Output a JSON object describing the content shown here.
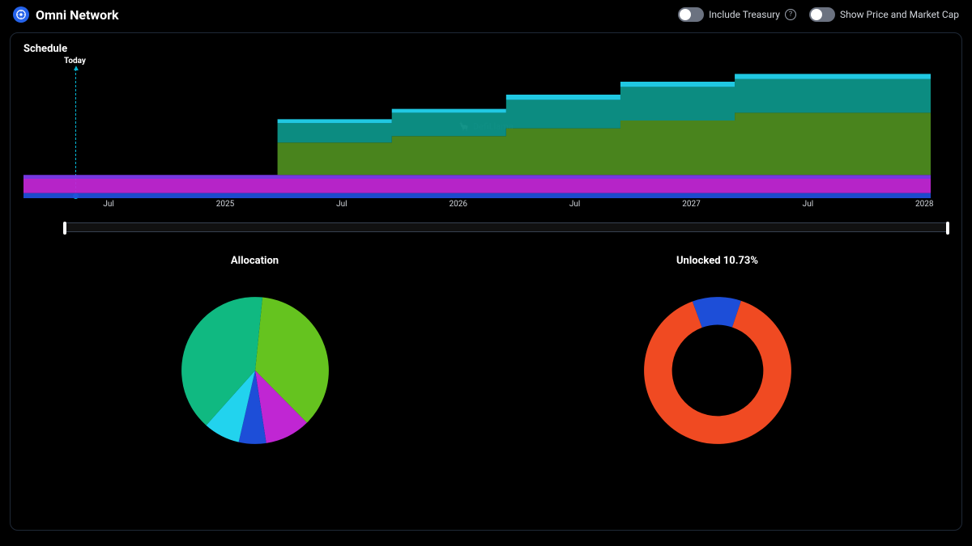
{
  "header": {
    "title": "Omni Network",
    "toggles": {
      "treasury_label": "Include Treasury",
      "price_label": "Show Price and Market Cap"
    }
  },
  "schedule": {
    "label": "Schedule",
    "today_label": "Today",
    "watermark": "DefiLlama"
  },
  "charts": {
    "allocation_title": "Allocation",
    "unlocked_title": "Unlocked 10.73%"
  },
  "chart_data": [
    {
      "type": "area",
      "title": "Schedule",
      "x_ticks": [
        "Jul",
        "2025",
        "Jul",
        "2026",
        "Jul",
        "2027",
        "Jul",
        "2028"
      ],
      "x_tick_positions_pct": [
        9.2,
        21.8,
        34.4,
        47.0,
        59.6,
        72.2,
        84.8,
        97.4
      ],
      "today_x_pct": 5.7,
      "series": [
        {
          "name": "blue",
          "color": "#1d4ed8",
          "const_height_pct": 4
        },
        {
          "name": "magenta",
          "color": "#c026d3",
          "const_height_pct": 11
        },
        {
          "name": "purple",
          "color": "#7c3aed",
          "const_height_pct": 3
        },
        {
          "name": "green",
          "color": "#4d8b1f",
          "step_heights_pct": [
            0,
            25,
            30,
            36,
            42,
            48,
            48
          ]
        },
        {
          "name": "teal",
          "color": "#0d9488",
          "step_heights_pct": [
            0,
            15,
            18,
            22,
            26,
            26,
            26
          ]
        },
        {
          "name": "cyan",
          "color": "#22d3ee",
          "step_heights_pct": [
            0,
            3,
            3,
            4,
            4,
            4,
            4
          ]
        }
      ],
      "step_x_pct": [
        0,
        28,
        40.6,
        53.2,
        65.8,
        78.4,
        100
      ],
      "ylim": [
        0,
        100
      ]
    },
    {
      "type": "pie",
      "title": "Allocation",
      "slices": [
        {
          "name": "green",
          "value": 36,
          "color": "#65c31f"
        },
        {
          "name": "magenta",
          "value": 10,
          "color": "#c026d3"
        },
        {
          "name": "blue",
          "value": 6,
          "color": "#1d4ed8"
        },
        {
          "name": "cyan",
          "value": 8,
          "color": "#22d3ee"
        },
        {
          "name": "teal",
          "value": 40,
          "color": "#10b981"
        }
      ]
    },
    {
      "type": "pie",
      "title": "Unlocked 10.73%",
      "donut": true,
      "slices": [
        {
          "name": "unlocked",
          "value": 10.73,
          "color": "#1d4ed8"
        },
        {
          "name": "locked",
          "value": 89.27,
          "color": "#f04a22"
        }
      ]
    }
  ]
}
